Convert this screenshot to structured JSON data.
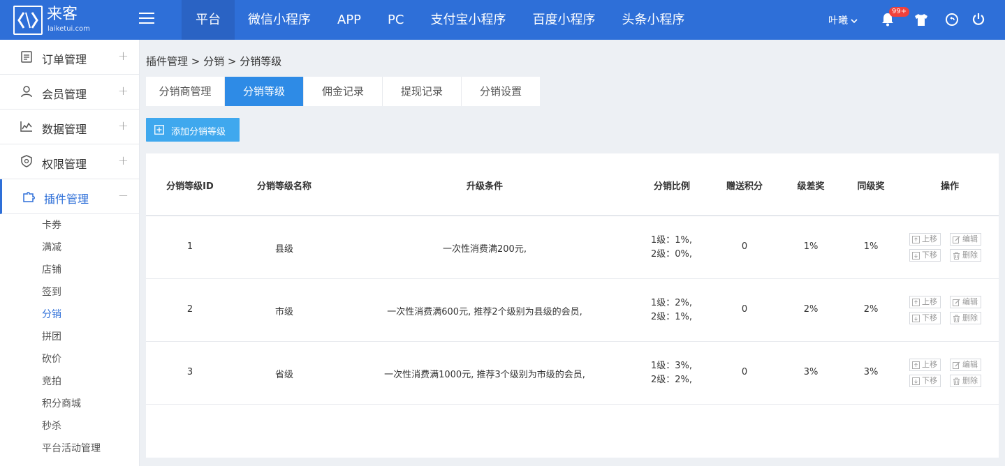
{
  "brand": {
    "name_cn": "来客",
    "name_en": "laiketui.com"
  },
  "topnav": [
    "平台",
    "微信小程序",
    "APP",
    "PC",
    "支付宝小程序",
    "百度小程序",
    "头条小程序"
  ],
  "user": {
    "name": "叶曦",
    "notification_count": "99+"
  },
  "sidebar": {
    "groups": [
      {
        "label": "订单管理",
        "sign": "+"
      },
      {
        "label": "会员管理",
        "sign": "+"
      },
      {
        "label": "数据管理",
        "sign": "+"
      },
      {
        "label": "权限管理",
        "sign": "+"
      },
      {
        "label": "插件管理",
        "sign": "−"
      }
    ],
    "subitems": [
      "卡券",
      "满减",
      "店铺",
      "签到",
      "分销",
      "拼团",
      "砍价",
      "竞拍",
      "积分商城",
      "秒杀",
      "平台活动管理"
    ]
  },
  "breadcrumb": "插件管理 > 分销 > 分销等级",
  "tabs": [
    "分销商管理",
    "分销等级",
    "佣金记录",
    "提现记录",
    "分销设置"
  ],
  "add_button": "添加分销等级",
  "table": {
    "headers": [
      "分销等级ID",
      "分销等级名称",
      "升级条件",
      "分销比例",
      "赠送积分",
      "级差奖",
      "同级奖",
      "操作"
    ],
    "rows": [
      {
        "id": "1",
        "name": "县级",
        "condition": "一次性消费满200元,",
        "ratio1": "1级：1%,",
        "ratio2": "2级：0%,",
        "points": "0",
        "diff": "1%",
        "same": "1%"
      },
      {
        "id": "2",
        "name": "市级",
        "condition": "一次性消费满600元, 推荐2个级别为县级的会员,",
        "ratio1": "1级：2%,",
        "ratio2": "2级：1%,",
        "points": "0",
        "diff": "2%",
        "same": "2%"
      },
      {
        "id": "3",
        "name": "省级",
        "condition": "一次性消费满1000元, 推荐3个级别为市级的会员,",
        "ratio1": "1级：3%,",
        "ratio2": "2级：2%,",
        "points": "0",
        "diff": "3%",
        "same": "3%"
      }
    ],
    "actions": {
      "up": "上移",
      "edit": "编辑",
      "down": "下移",
      "delete": "删除"
    }
  },
  "colors": {
    "topbar": "#2e6fd8",
    "tab_active": "#2e8be6",
    "add_button": "#3fa8ee",
    "badge": "#f0413c"
  }
}
